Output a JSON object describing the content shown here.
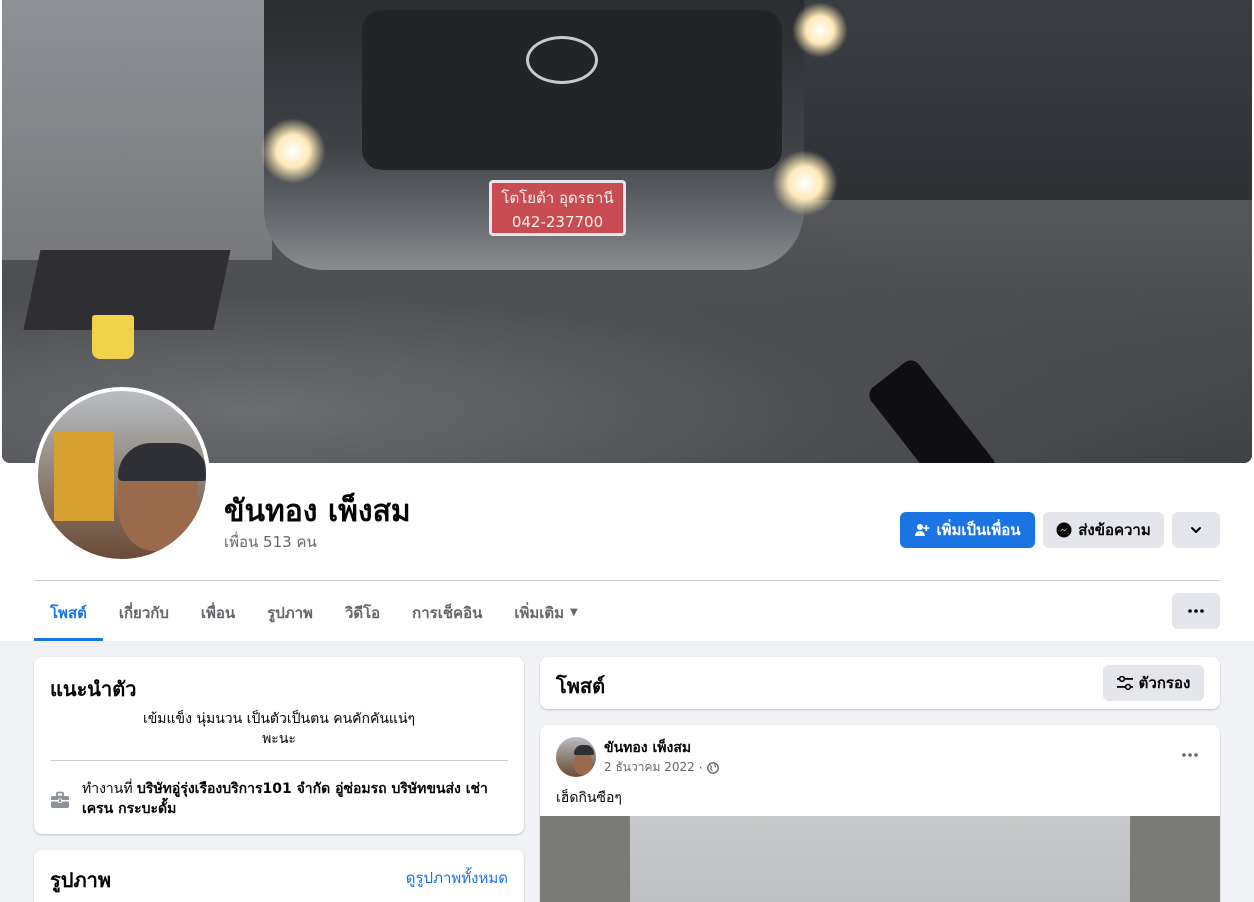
{
  "profile": {
    "name": "ขันทอง เพ็งสม",
    "friends_count": "เพื่อน 513 คน"
  },
  "cover": {
    "plate_line1": "โตโยต้า อุดรธานี",
    "plate_line2": "042-237700"
  },
  "actions": {
    "add_friend": "เพิ่มเป็นเพื่อน",
    "message": "ส่งข้อความ",
    "add_friend_icon": "user-plus-icon",
    "message_icon": "messenger-icon",
    "dropdown_icon": "chevron-down-icon",
    "more_icon": "ellipsis-icon"
  },
  "tabs": [
    {
      "label": "โพสต์",
      "active": true
    },
    {
      "label": "เกี่ยวกับ",
      "active": false
    },
    {
      "label": "เพื่อน",
      "active": false
    },
    {
      "label": "รูปภาพ",
      "active": false
    },
    {
      "label": "วิดีโอ",
      "active": false
    },
    {
      "label": "การเช็คอิน",
      "active": false
    },
    {
      "label": "เพิ่มเติม",
      "active": false
    }
  ],
  "intro": {
    "title": "แนะนำตัว",
    "bio_line1": "เข้มแข็ง นุ่มนวน เป็นตัวเป็นตน คนคักคันแน่ๆ",
    "bio_line2": "พะนะ",
    "work_prefix": "ทำงานที่",
    "work_place": "บริษัทอู่รุ่งเรืองบริการ101 จำกัด อู่ซ่อมรถ บริษัทขนส่ง เช่าเครน กระบะดั้ม",
    "work_icon": "briefcase-icon"
  },
  "photos": {
    "title": "รูปภาพ",
    "see_all": "ดูรูปภาพทั้งหมด"
  },
  "posts": {
    "title": "โพสต์",
    "filter_label": "ตัวกรอง",
    "filter_icon": "filter-icon"
  },
  "post": {
    "author": "ขันทอง เพ็งสม",
    "date": "2 ธันวาคม 2022",
    "separator": "·",
    "privacy_icon": "globe-icon",
    "text": "เฮ็ดกินซือๆ",
    "menu_icon": "ellipsis-icon"
  },
  "colors": {
    "accent": "#1b74e4",
    "background": "#f0f2f5",
    "secondary_button": "#e4e6eb",
    "text_secondary": "#65676b"
  }
}
